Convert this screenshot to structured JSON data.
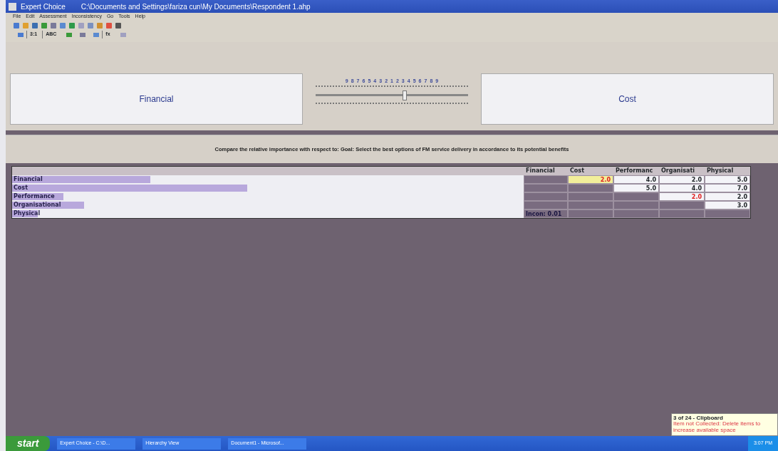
{
  "window": {
    "app": "Expert Choice",
    "path": "C:\\Documents and Settings\\fariza cun\\My Documents\\Respondent 1.ahp"
  },
  "menu": [
    "File",
    "Edit",
    "Assessment",
    "Inconsistency",
    "Go",
    "Tools",
    "Help"
  ],
  "toolbar2": [
    {
      "kind": "icon"
    },
    {
      "kind": "text",
      "label": "3:1"
    },
    {
      "kind": "text",
      "label": "ABC"
    },
    {
      "kind": "icon"
    },
    {
      "kind": "icon"
    },
    {
      "kind": "icon"
    },
    {
      "kind": "text",
      "label": "fx"
    },
    {
      "kind": "icon"
    }
  ],
  "compare": {
    "left": "Financial",
    "right": "Cost",
    "scale": [
      "9",
      "8",
      "7",
      "6",
      "5",
      "4",
      "3",
      "2",
      "1",
      "2",
      "3",
      "4",
      "5",
      "6",
      "7",
      "8",
      "9"
    ],
    "level": 0.57
  },
  "instruction": "Compare the relative importance with respect to: Goal: Select the best options of FM service delivery in accordance to its potential benefits",
  "matrix": {
    "columns": [
      "Financial",
      "Cost",
      "Performanc",
      "Organisati",
      "Physical"
    ],
    "rows": [
      {
        "name": "Financial",
        "level": 0.27,
        "cells": [
          {
            "kind": "blank"
          },
          {
            "kind": "value",
            "text": "2.0",
            "selected": true,
            "flagged": true
          },
          {
            "kind": "value",
            "text": "4.0",
            "selected": false,
            "flagged": false
          },
          {
            "kind": "value",
            "text": "2.0",
            "selected": false,
            "flagged": false
          },
          {
            "kind": "value",
            "text": "5.0",
            "selected": false,
            "flagged": false
          }
        ]
      },
      {
        "name": "Cost",
        "level": 0.46,
        "cells": [
          {
            "kind": "blank"
          },
          {
            "kind": "blank"
          },
          {
            "kind": "value",
            "text": "5.0",
            "selected": false,
            "flagged": false
          },
          {
            "kind": "value",
            "text": "4.0",
            "selected": false,
            "flagged": false
          },
          {
            "kind": "value",
            "text": "7.0",
            "selected": false,
            "flagged": false
          }
        ]
      },
      {
        "name": "Performance",
        "level": 0.1,
        "cells": [
          {
            "kind": "blank"
          },
          {
            "kind": "blank"
          },
          {
            "kind": "blank"
          },
          {
            "kind": "value",
            "text": "2.0",
            "selected": false,
            "flagged": true
          },
          {
            "kind": "value",
            "text": "2.0",
            "selected": false,
            "flagged": false
          }
        ]
      },
      {
        "name": "Organisational",
        "level": 0.14,
        "cells": [
          {
            "kind": "blank"
          },
          {
            "kind": "blank"
          },
          {
            "kind": "blank"
          },
          {
            "kind": "blank"
          },
          {
            "kind": "value",
            "text": "3.0",
            "selected": false,
            "flagged": false
          }
        ]
      },
      {
        "name": "Physical",
        "level": 0.05,
        "cells": [
          {
            "kind": "note",
            "text": "Incon: 0.01"
          },
          {
            "kind": "blank"
          },
          {
            "kind": "blank"
          },
          {
            "kind": "blank"
          },
          {
            "kind": "blank"
          }
        ]
      }
    ]
  },
  "clipboard": {
    "title": "3 of 24 - Clipboard",
    "message": "Item not Collected: Delete items to increase available space"
  },
  "taskbar": {
    "start": "start",
    "tasks": [
      "Expert Choice - C:\\D...",
      "Hierarchy View",
      "Document1 - Microsof..."
    ],
    "time": "3:07 PM"
  }
}
